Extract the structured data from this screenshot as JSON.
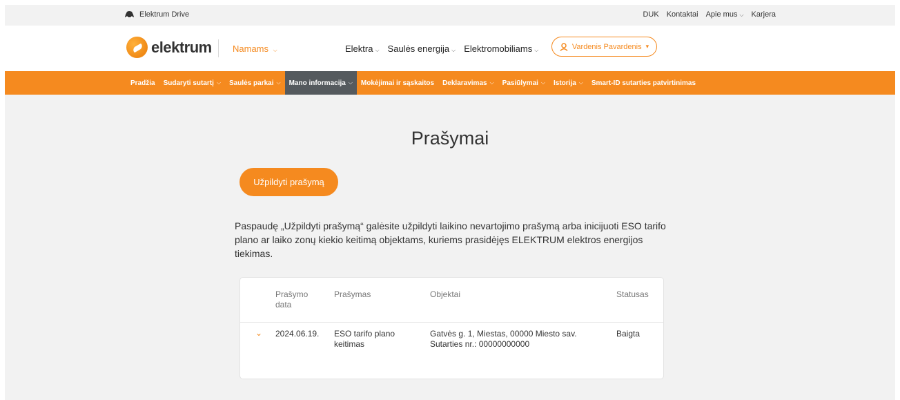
{
  "utility": {
    "drive_label": "Elektrum Drive",
    "links": [
      "DUK",
      "Kontaktai",
      "Apie mus",
      "Karjera"
    ]
  },
  "header": {
    "logo_text": "elektrum",
    "segment": "Namams",
    "nav": [
      "Elektra",
      "Saulės energija",
      "Elektromobiliams"
    ],
    "user_name": "Vardenis Pavardenis"
  },
  "subnav": {
    "items": [
      "Pradžia",
      "Sudaryti sutartį",
      "Saulės parkai",
      "Mano informacija",
      "Mokėjimai ir sąskaitos",
      "Deklaravimas",
      "Pasiūlymai",
      "Istorija",
      "Smart-ID sutarties patvirtinimas"
    ],
    "active": "Mano informacija"
  },
  "main": {
    "title": "Prašymai",
    "fill_button": "Užpildyti prašymą",
    "description": "Paspaudę „Užpildyti prašymą“ galėsite užpildyti laikino nevartojimo prašymą arba inicijuoti ESO tarifo plano ar laiko zonų kiekio keitimą objektams, kuriems prasidėjęs ELEKTRUM elektros energijos tiekimas."
  },
  "table": {
    "headers": [
      "Prašymo data",
      "Prašymas",
      "Objektai",
      "Statusas"
    ],
    "rows": [
      {
        "date": "2024.06.19.",
        "request": "ESO tarifo plano keitimas",
        "object_address": "Gatvės g. 1, Miestas, 00000 Miesto sav.",
        "object_contract": "Sutarties nr.: 00000000000",
        "status": "Baigta"
      }
    ]
  },
  "colors": {
    "accent": "#f58a1f",
    "active_nav": "#555a5e"
  }
}
